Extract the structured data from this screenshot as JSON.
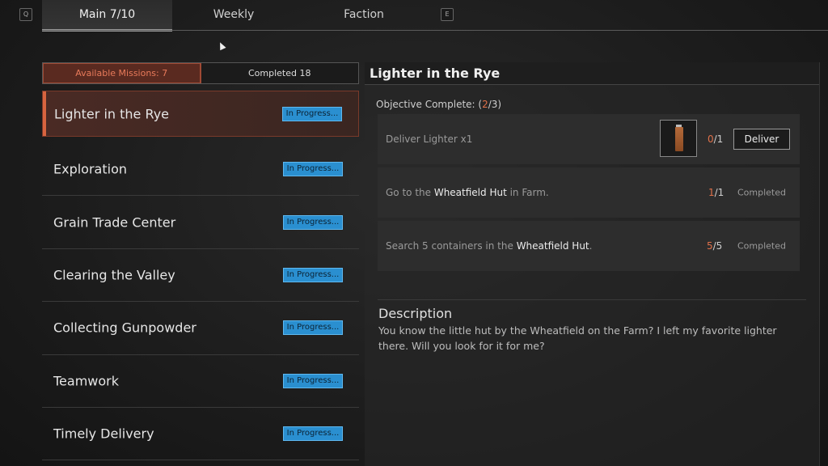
{
  "topbar": {
    "left_key": "Q",
    "right_key": "E",
    "tabs": [
      {
        "label": "Main  7/10",
        "active": true
      },
      {
        "label": "Weekly",
        "active": false
      },
      {
        "label": "Faction",
        "active": false
      }
    ]
  },
  "filters": {
    "available": "Available Missions: 7",
    "completed": "Completed 18"
  },
  "missions": [
    {
      "name": "Lighter in the Rye",
      "status": "In Progress...",
      "active": true
    },
    {
      "name": "Exploration",
      "status": "In Progress..."
    },
    {
      "name": "Grain Trade Center",
      "status": "In Progress..."
    },
    {
      "name": "Clearing the Valley",
      "status": "In Progress..."
    },
    {
      "name": "Collecting Gunpowder",
      "status": "In Progress..."
    },
    {
      "name": "Teamwork",
      "status": "In Progress..."
    },
    {
      "name": "Timely Delivery",
      "status": "In Progress..."
    }
  ],
  "detail": {
    "title": "Lighter in the Rye",
    "objective_label": "Objective Complete: (",
    "objective_done": "2",
    "objective_total": "/3)",
    "objectives": [
      {
        "pre": "Deliver Lighter x1",
        "highlight": "",
        "post": "",
        "done": "0",
        "total": "/1",
        "action": "Deliver",
        "item_icon": "lighter-icon"
      },
      {
        "pre": "Go to the ",
        "highlight": "Wheatfield Hut",
        "post": " in Farm.",
        "done": "1",
        "total": "/1",
        "state": "Completed"
      },
      {
        "pre": "Search 5 containers in the ",
        "highlight": "Wheatfield Hut",
        "post": ".",
        "done": "5",
        "total": "/5",
        "state": "Completed"
      }
    ],
    "description_title": "Description",
    "description": "You know the little hut by the Wheatfield on the Farm? I left my favorite lighter there. Will you look for it for me?"
  },
  "colors": {
    "accent": "#e0714a",
    "status_badge": "#2a8fd0",
    "active_mission_bg": "#4a2a24"
  }
}
